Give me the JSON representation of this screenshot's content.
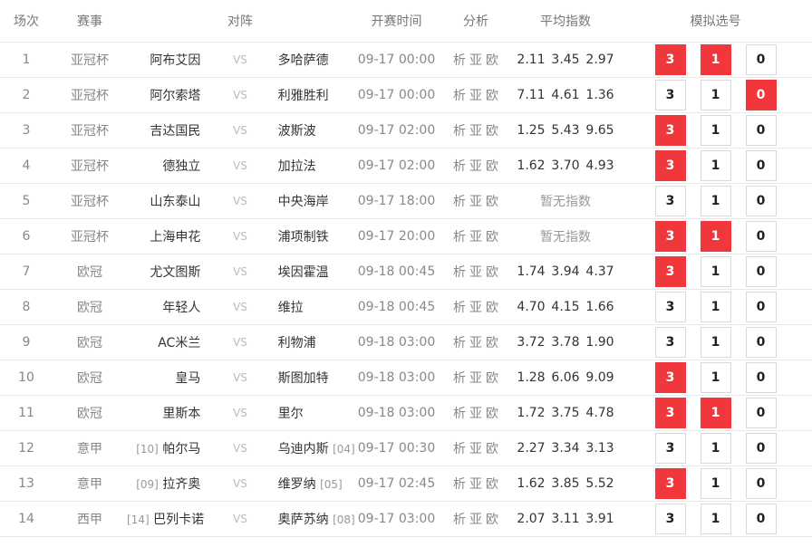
{
  "headers": {
    "no": "场次",
    "league": "赛事",
    "match": "对阵",
    "time": "开赛时间",
    "analysis": "分析",
    "odds": "平均指数",
    "sim": "模拟选号"
  },
  "vs": "VS",
  "analysis_links": [
    "析",
    "亚",
    "欧"
  ],
  "pick_labels": [
    "3",
    "1",
    "0"
  ],
  "colors": {
    "selected": "#f0373b"
  },
  "rows": [
    {
      "no": "1",
      "league": "亚冠杯",
      "home": "阿布艾因",
      "home_rank": "",
      "away": "多哈萨德",
      "away_rank": "",
      "time": "09-17 00:00",
      "odds": [
        "2.11",
        "3.45",
        "2.97"
      ],
      "nodds": "",
      "p3": true,
      "p1": true,
      "p0": false
    },
    {
      "no": "2",
      "league": "亚冠杯",
      "home": "阿尔索塔",
      "home_rank": "",
      "away": "利雅胜利",
      "away_rank": "",
      "time": "09-17 00:00",
      "odds": [
        "7.11",
        "4.61",
        "1.36"
      ],
      "nodds": "",
      "p3": false,
      "p1": false,
      "p0": true
    },
    {
      "no": "3",
      "league": "亚冠杯",
      "home": "吉达国民",
      "home_rank": "",
      "away": "波斯波",
      "away_rank": "",
      "time": "09-17 02:00",
      "odds": [
        "1.25",
        "5.43",
        "9.65"
      ],
      "nodds": "",
      "p3": true,
      "p1": false,
      "p0": false
    },
    {
      "no": "4",
      "league": "亚冠杯",
      "home": "德独立",
      "home_rank": "",
      "away": "加拉法",
      "away_rank": "",
      "time": "09-17 02:00",
      "odds": [
        "1.62",
        "3.70",
        "4.93"
      ],
      "nodds": "",
      "p3": true,
      "p1": false,
      "p0": false
    },
    {
      "no": "5",
      "league": "亚冠杯",
      "home": "山东泰山",
      "home_rank": "",
      "away": "中央海岸",
      "away_rank": "",
      "time": "09-17 18:00",
      "odds": [],
      "nodds": "暂无指数",
      "p3": false,
      "p1": false,
      "p0": false
    },
    {
      "no": "6",
      "league": "亚冠杯",
      "home": "上海申花",
      "home_rank": "",
      "away": "浦项制铁",
      "away_rank": "",
      "time": "09-17 20:00",
      "odds": [],
      "nodds": "暂无指数",
      "p3": true,
      "p1": true,
      "p0": false
    },
    {
      "no": "7",
      "league": "欧冠",
      "home": "尤文图斯",
      "home_rank": "",
      "away": "埃因霍温",
      "away_rank": "",
      "time": "09-18 00:45",
      "odds": [
        "1.74",
        "3.94",
        "4.37"
      ],
      "nodds": "",
      "p3": true,
      "p1": false,
      "p0": false
    },
    {
      "no": "8",
      "league": "欧冠",
      "home": "年轻人",
      "home_rank": "",
      "away": "维拉",
      "away_rank": "",
      "time": "09-18 00:45",
      "odds": [
        "4.70",
        "4.15",
        "1.66"
      ],
      "nodds": "",
      "p3": false,
      "p1": false,
      "p0": false
    },
    {
      "no": "9",
      "league": "欧冠",
      "home": "AC米兰",
      "home_rank": "",
      "away": "利物浦",
      "away_rank": "",
      "time": "09-18 03:00",
      "odds": [
        "3.72",
        "3.78",
        "1.90"
      ],
      "nodds": "",
      "p3": false,
      "p1": false,
      "p0": false
    },
    {
      "no": "10",
      "league": "欧冠",
      "home": "皇马",
      "home_rank": "",
      "away": "斯图加特",
      "away_rank": "",
      "time": "09-18 03:00",
      "odds": [
        "1.28",
        "6.06",
        "9.09"
      ],
      "nodds": "",
      "p3": true,
      "p1": false,
      "p0": false
    },
    {
      "no": "11",
      "league": "欧冠",
      "home": "里斯本",
      "home_rank": "",
      "away": "里尔",
      "away_rank": "",
      "time": "09-18 03:00",
      "odds": [
        "1.72",
        "3.75",
        "4.78"
      ],
      "nodds": "",
      "p3": true,
      "p1": true,
      "p0": false
    },
    {
      "no": "12",
      "league": "意甲",
      "home": "帕尔马",
      "home_rank": "[10]",
      "away": "乌迪内斯",
      "away_rank": "[04]",
      "time": "09-17 00:30",
      "odds": [
        "2.27",
        "3.34",
        "3.13"
      ],
      "nodds": "",
      "p3": false,
      "p1": false,
      "p0": false
    },
    {
      "no": "13",
      "league": "意甲",
      "home": "拉齐奥",
      "home_rank": "[09]",
      "away": "维罗纳",
      "away_rank": "[05]",
      "time": "09-17 02:45",
      "odds": [
        "1.62",
        "3.85",
        "5.52"
      ],
      "nodds": "",
      "p3": true,
      "p1": false,
      "p0": false
    },
    {
      "no": "14",
      "league": "西甲",
      "home": "巴列卡诺",
      "home_rank": "[14]",
      "away": "奥萨苏纳",
      "away_rank": "[08]",
      "time": "09-17 03:00",
      "odds": [
        "2.07",
        "3.11",
        "3.91"
      ],
      "nodds": "",
      "p3": false,
      "p1": false,
      "p0": false
    }
  ]
}
